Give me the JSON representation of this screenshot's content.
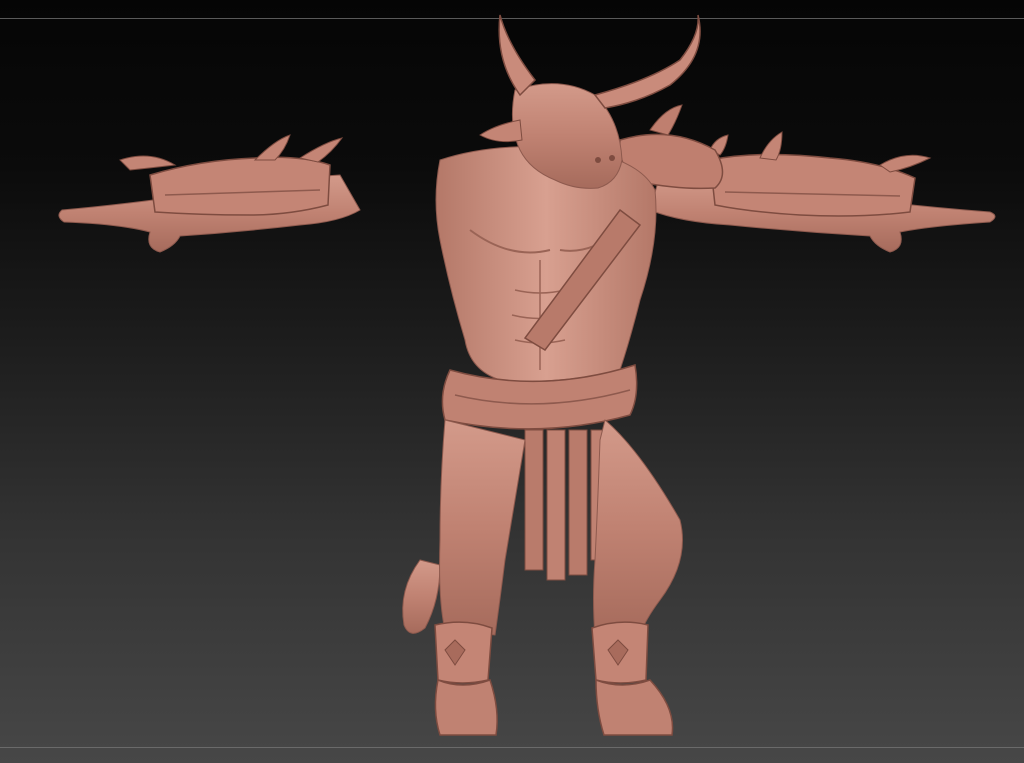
{
  "viewport": {
    "kind": "3d-sculpt-canvas",
    "subject": "minotaur-sculpt",
    "colors": {
      "bg_top": "#050505",
      "bg_bottom": "#474747",
      "clay": "#c7897a",
      "clay_dark": "#8e5a4e",
      "clay_light": "#e0a898"
    }
  }
}
